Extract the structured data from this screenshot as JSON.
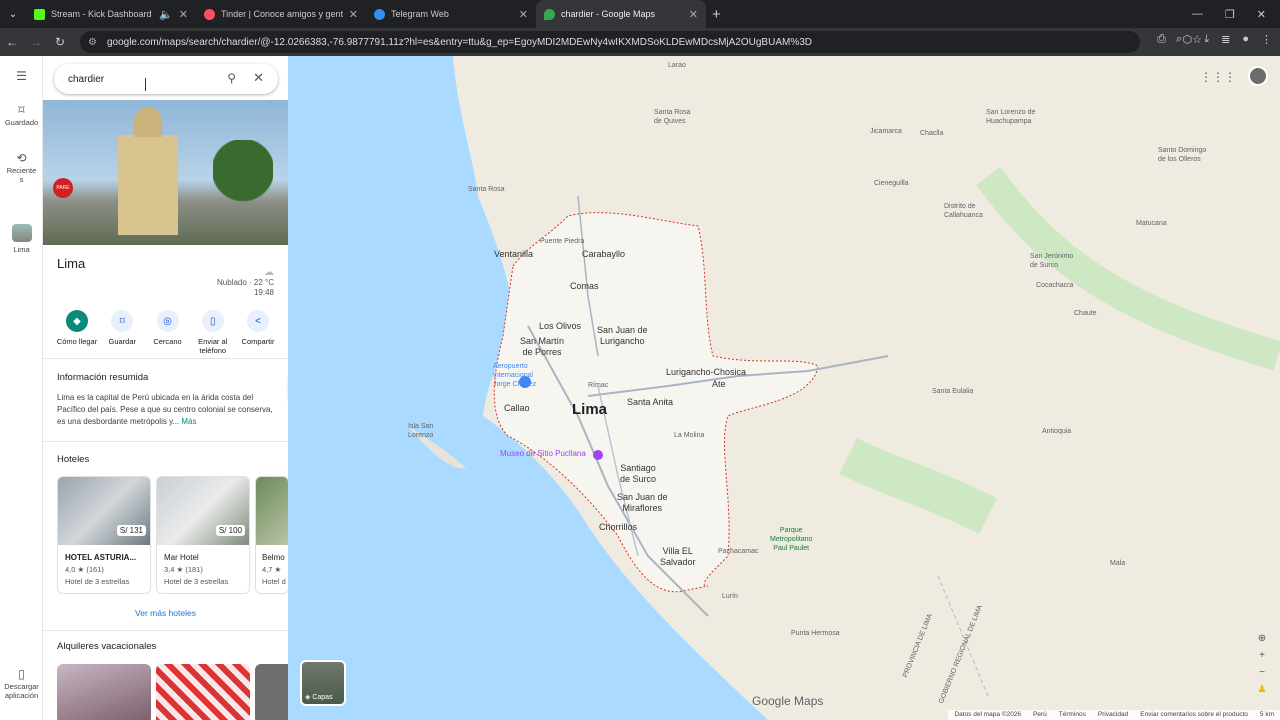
{
  "browser": {
    "tabs": [
      {
        "title": "Stream - Kick Dashboard",
        "color": "#53fc18"
      },
      {
        "title": "Tinder | Conoce amigos y gente",
        "color": "#fd4f63"
      },
      {
        "title": "Telegram Web",
        "color": "#3390ec"
      },
      {
        "title": "chardier - Google Maps",
        "color": "#34a853"
      }
    ],
    "url": "google.com/maps/search/chardier/@-12.0266383,-76.9877791,11z?hl=es&entry=ttu&g_ep=EgoyMDI2MDEwNy4wIKXMDSoKLDEwMDcsMjA2OUgBUAM%3D"
  },
  "rail": {
    "saved": "Guardado",
    "recent": "Reciente\ns",
    "place": "Lima",
    "download": "Descargar\naplicación"
  },
  "search": {
    "value": "chardier"
  },
  "place": {
    "name": "Lima",
    "weather": "Nublado · 22 °C",
    "time": "19:48",
    "actions": [
      "Cómo llegar",
      "Guardar",
      "Cercano",
      "Enviar al teléfono",
      "Compartir"
    ],
    "summary_heading": "Información resumida",
    "summary": "Lima es la capital de Perú ubicada en la árida costa del Pacífico del país. Pese a que su centro colonial se conserva, es una desbordante metrópolis y...",
    "more": "Más",
    "hotels_heading": "Hoteles",
    "hotels": [
      {
        "name": "HOTEL ASTURIA...",
        "price": "S/ 131",
        "rating": "4,0 ★ (161)",
        "stars": "Hotel de 3 estrellas"
      },
      {
        "name": "Mar Hotel",
        "price": "S/ 100",
        "rating": "3,4 ★ (181)",
        "stars": "Hotel de 3 estrellas"
      },
      {
        "name": "Belmo",
        "price": "",
        "rating": "4,7 ★",
        "stars": "Hotel d"
      }
    ],
    "more_hotels": "Ver más hoteles",
    "rentals_heading": "Alquileres vacacionales"
  },
  "map": {
    "layers": "Capas",
    "brand": "Google Maps",
    "footer": [
      "Datos del mapa ©2026",
      "Perú",
      "Términos",
      "Privacidad",
      "Enviar comentarios sobre el producto",
      "5 km"
    ],
    "labels": {
      "lima": "Lima",
      "callao": "Callao",
      "ventanilla": "Ventanilla",
      "carabayllo": "Carabayllo",
      "comas": "Comas",
      "losolivos": "Los Olivos",
      "sjl": "San Juan de\nLurigancho",
      "smp": "San Martín\nde Porres",
      "rimac": "Rímac",
      "santaanita": "Santa Anita",
      "lurigancho": "Lurigancho-Chosica",
      "ate": "Ate",
      "surco": "Santiago\nde Surco",
      "sjm": "San Juan de\nMiraflores",
      "chorrillos": "Chorrillos",
      "ves": "Villa EL\nSalvador",
      "museo": "Museo de Sitio Pucllana",
      "aeropuerto": "Aeropuerto\nInternacional\nJorge Chávez",
      "sanlorenzo": "Isla San\nLorenzo",
      "lamolina": "La Molina",
      "pachacamac": "Pachacamac",
      "santarosa": "Santa Rosa",
      "puentepiedra": "Puente Piedra",
      "ancon": "Larao",
      "huarochiri": "San Jerónimo\nde Surco",
      "chaclla": "Chaclla",
      "santaeulalia": "Santa Eulalia",
      "cieneguilla": "Cieneguilla",
      "puntahermosa": "Punta Hermosa",
      "lurin": "Lurín",
      "chilca": "Mala",
      "pmpa": "Parque\nMetropolitano\nPaul Paulet",
      "sanbartolo": "Santo Domingo\nde los Olleros",
      "antioquia": "Antioquia",
      "huachupampa": "San Lorenzo de\nHuachupampa",
      "callahuanca": "Distrito de\nCallahuanca",
      "cocachacra": "Cocachacra",
      "chaute": "Chaute",
      "matucana": "Matucana",
      "provlima": "PROVINCIA DE LIMA",
      "gobreg": "GOBIERNO REGIONAL DE LIMA",
      "jicamarca": "Jicamarca",
      "canta": "Santa Rosa\nde Quives"
    }
  }
}
